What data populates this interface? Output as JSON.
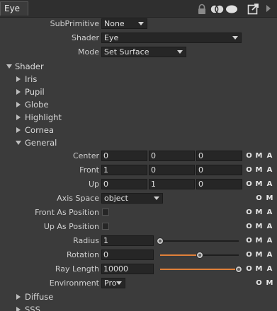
{
  "tab_title": "Eye",
  "icons": {
    "lock": "lock-icon",
    "link": "link-icon",
    "float": "float-icon",
    "menu": "menu-arrow-icon"
  },
  "accent_color": "#e0803a",
  "top": {
    "subprimitive": {
      "label": "SubPrimitive",
      "value": "None"
    },
    "shader": {
      "label": "Shader",
      "value": "Eye"
    },
    "mode": {
      "label": "Mode",
      "value": "Set Surface"
    }
  },
  "shader_section": "Shader",
  "subsections": [
    "Iris",
    "Pupil",
    "Globe",
    "Highlight",
    "Cornea"
  ],
  "general": {
    "title": "General",
    "center": {
      "label": "Center",
      "values": [
        "0",
        "0",
        "0"
      ]
    },
    "front": {
      "label": "Front",
      "values": [
        "1",
        "0",
        "0"
      ]
    },
    "up": {
      "label": "Up",
      "values": [
        "0",
        "1",
        "0"
      ]
    },
    "axis_space": {
      "label": "Axis Space",
      "value": "object"
    },
    "front_as_position": {
      "label": "Front As Position",
      "checked": false
    },
    "up_as_position": {
      "label": "Up As Position",
      "checked": false
    },
    "radius": {
      "label": "Radius",
      "value": "1",
      "fraction": 0.0
    },
    "rotation": {
      "label": "Rotation",
      "value": "0",
      "fraction": 0.5
    },
    "ray_length": {
      "label": "Ray Length",
      "value": "10000",
      "fraction": 1.0
    },
    "environment": {
      "label": "Environment",
      "value": "Pro"
    }
  },
  "after": [
    "Diffuse",
    "SSS"
  ],
  "oma": {
    "o": "O",
    "m": "M",
    "a": "A"
  }
}
